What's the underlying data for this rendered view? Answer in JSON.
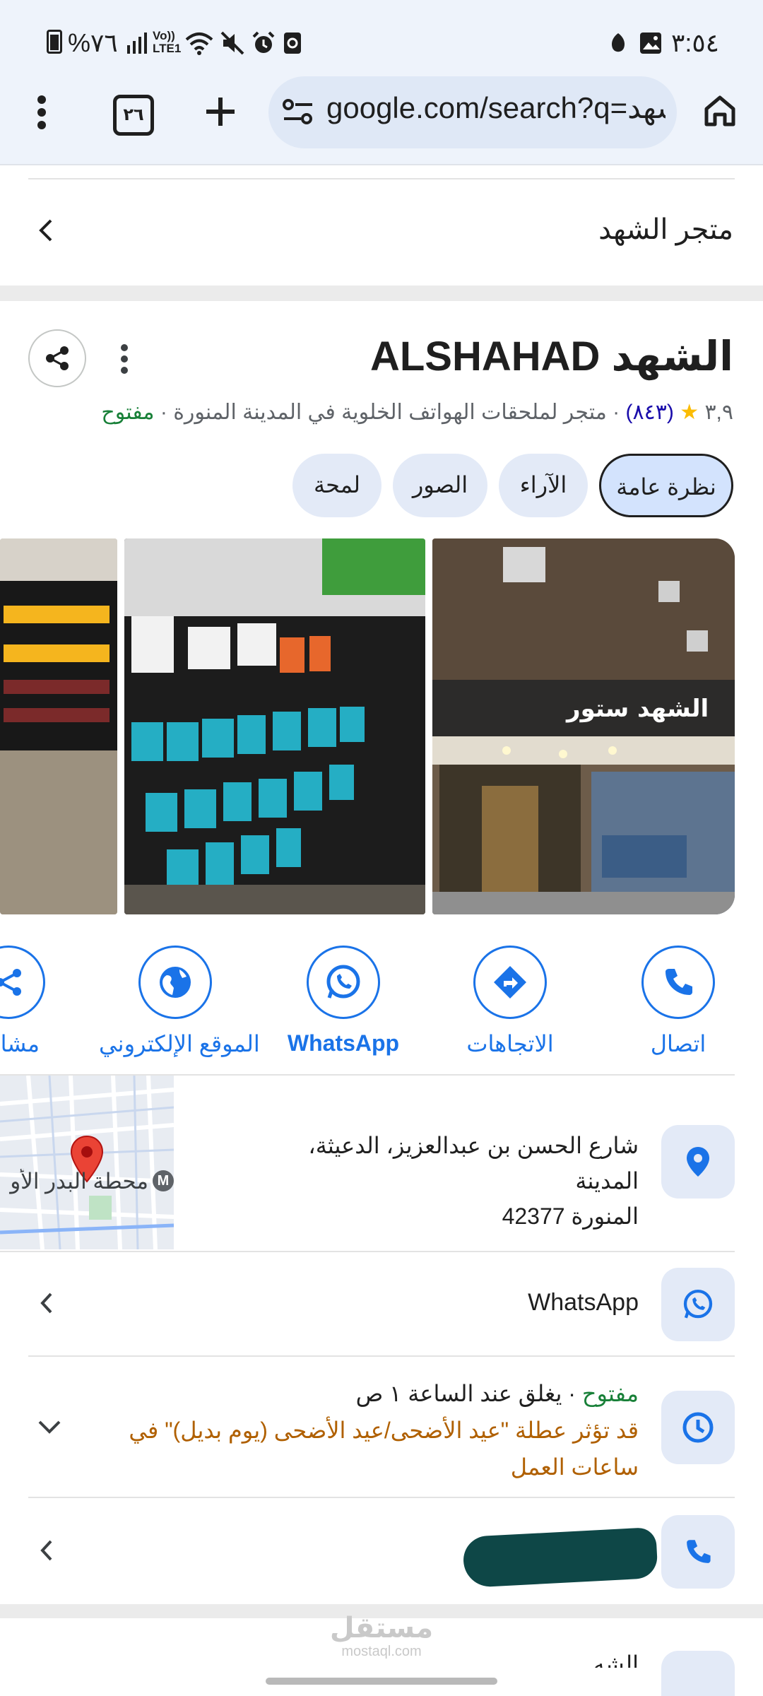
{
  "status_bar": {
    "time": "٣:٥٤",
    "battery": "%٧٦",
    "network": "LTE1",
    "volte": "Vo))"
  },
  "browser": {
    "url": "google.com/search?q=الشهد",
    "tab_count": "٢٦"
  },
  "header_row": {
    "title": "متجر الشهد"
  },
  "business": {
    "name": "الشهد ALSHAHAD",
    "rating": "٣,٩",
    "reviews": "(٨٤٣)",
    "category": "متجر لملحقات الهواتف الخلوية في المدينة المنورة",
    "status": "مفتوح",
    "separator": "·"
  },
  "tabs": [
    {
      "label": "نظرة عامة",
      "active": true
    },
    {
      "label": "الآراء",
      "active": false
    },
    {
      "label": "الصور",
      "active": false
    },
    {
      "label": "لمحة",
      "active": false
    }
  ],
  "actions": [
    {
      "label": "اتصال",
      "icon": "phone-icon"
    },
    {
      "label": "الاتجاهات",
      "icon": "directions-icon"
    },
    {
      "label": "WhatsApp",
      "icon": "whatsapp-icon"
    },
    {
      "label": "الموقع الإلكتروني",
      "icon": "globe-icon"
    },
    {
      "label": "مشار",
      "icon": "share-icon"
    }
  ],
  "address": {
    "line1": "شارع الحسن بن عبدالعزيز، الدعيثة، المدينة",
    "line2": "المنورة 42377",
    "map_label": "محطة البدر الأو",
    "map_marker": "M"
  },
  "whatsapp_row": {
    "label": "WhatsApp"
  },
  "hours": {
    "status": "مفتوح",
    "separator": "·",
    "closes": "يغلق عند الساعة ١ ص",
    "holiday_line1": "قد تؤثر عطلة \"عيد الأضحى/عيد الأضحى (يوم بديل)\" في",
    "holiday_line2": "ساعات العمل"
  },
  "bottom_partial": {
    "label": "الشه"
  },
  "watermark": {
    "arabic": "مستقل",
    "latin": "mostaql.com"
  },
  "colors": {
    "accent": "#1a73e8",
    "open_green": "#188038",
    "warning_amber": "#b06000",
    "star": "#fbbc04"
  }
}
